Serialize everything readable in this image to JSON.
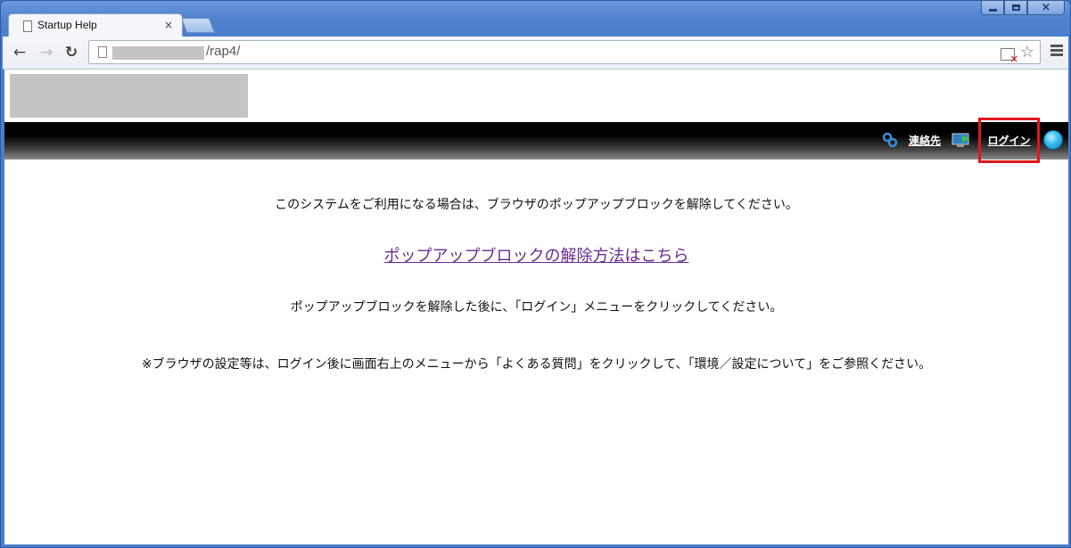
{
  "window": {
    "controls": {
      "minimize": "minimize",
      "maximize": "maximize",
      "close": "close"
    }
  },
  "tab": {
    "title": "Startup Help",
    "close_glyph": "×"
  },
  "toolbar": {
    "back_glyph": "←",
    "forward_glyph": "→",
    "reload_glyph": "↻",
    "url_path": "/rap4/",
    "star_glyph": "☆",
    "blocked_glyph": "✕"
  },
  "header_nav": {
    "contact_label": "連絡先",
    "login_label": "ログイン",
    "highlight_color": "#e0161b"
  },
  "main": {
    "message1": "このシステムをご利用になる場合は、ブラウザのポップアップブロックを解除してください。",
    "link_text": "ポップアップブロックの解除方法はこちら",
    "message2": "ポップアップブロックを解除した後に、「ログイン」メニューをクリックしてください。",
    "message3": "※ブラウザの設定等は、ログイン後に画面右上のメニューから「よくある質問」をクリックして、「環境／設定について」をご参照ください。"
  }
}
